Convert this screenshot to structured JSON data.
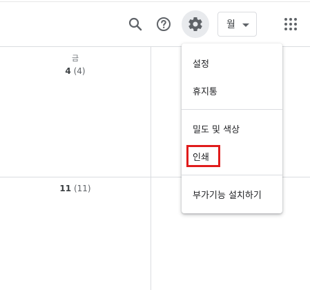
{
  "toolbar": {
    "search_icon": "search-icon",
    "help_icon": "help-icon",
    "settings_icon": "gear-icon",
    "view_select": {
      "label": "월"
    },
    "apps_icon": "apps-grid-icon"
  },
  "calendar": {
    "weekday": "금",
    "cells": [
      {
        "day": "4",
        "sub": "(4)"
      },
      {
        "day": "11",
        "sub": "(11)"
      }
    ]
  },
  "settings_menu": {
    "items": [
      {
        "label": "설정"
      },
      {
        "label": "휴지통"
      },
      {
        "label": "밀도 및 색상"
      },
      {
        "label": "인쇄",
        "highlight_color": "#e01b1b"
      },
      {
        "label": "부가기능 설치하기"
      }
    ]
  },
  "colors": {
    "active_icon_bg": "#e8eaed",
    "grid_line": "#dadce0",
    "highlight": "#e01b1b"
  }
}
